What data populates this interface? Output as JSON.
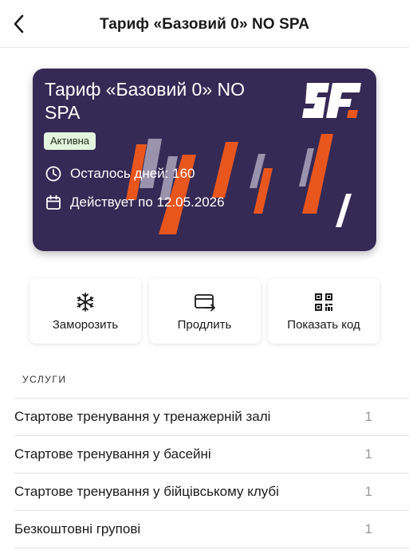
{
  "header": {
    "title": "Тариф «Базовий 0»  NO SPA",
    "back_icon": "chevron-left-icon"
  },
  "card": {
    "title": "Тариф «Базовий 0» NO SPA",
    "status": "Активна",
    "days_left_label": "Осталось дней: 160",
    "valid_until_label": "Действует по 12.05.2026",
    "logo_text": "SF",
    "colors": {
      "background": "#352a55",
      "accent": "#e8561e",
      "badge_bg": "#e3f5df"
    }
  },
  "actions": [
    {
      "label": "Заморозить",
      "icon": "snowflake-icon"
    },
    {
      "label": "Продлить",
      "icon": "card-renew-icon"
    },
    {
      "label": "Показать код",
      "icon": "qr-code-icon"
    }
  ],
  "services": {
    "title": "УСЛУГИ",
    "items": [
      {
        "name": "Стартове тренування у тренажерній залі",
        "count": "1"
      },
      {
        "name": "Стартове тренування у басейні",
        "count": "1"
      },
      {
        "name": "Стартове тренування у бійцівському клубі",
        "count": "1"
      },
      {
        "name": "Безкоштовні групові",
        "count": "1"
      }
    ]
  }
}
